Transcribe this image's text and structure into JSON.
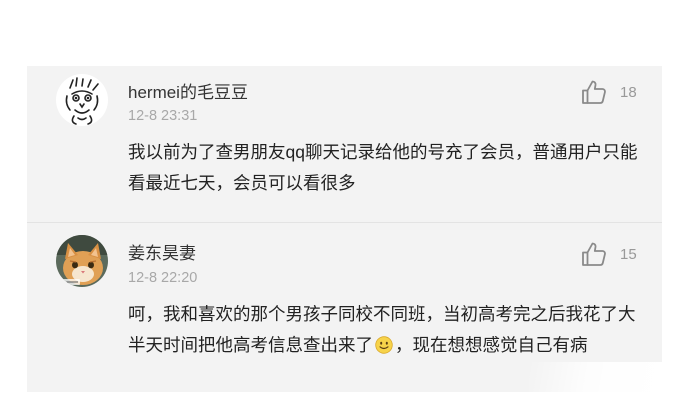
{
  "comments": [
    {
      "username": "hermei的毛豆豆",
      "timestamp": "12-8 23:31",
      "likes": "18",
      "text": "我以前为了查男朋友qq聊天记录给他的号充了会员，普通用户只能看最近七天，会员可以看很多",
      "avatar_icon": "cartoon-face-sketch"
    },
    {
      "username": "姜东昊妻",
      "timestamp": "12-8 22:20",
      "likes": "15",
      "text_before": "呵，我和喜欢的那个男孩子同校不同班，当初高考完之后我花了大半天时间把他高考信息查出来了",
      "text_emoji": "slightly-smiling-face-emoji",
      "text_after": "，现在想想感觉自己有病",
      "avatar_icon": "orange-cat-photo"
    }
  ],
  "colors": {
    "card_bg": "#f3f3f3",
    "username": "#333333",
    "meta": "#a8a8a8",
    "body": "#222222"
  }
}
